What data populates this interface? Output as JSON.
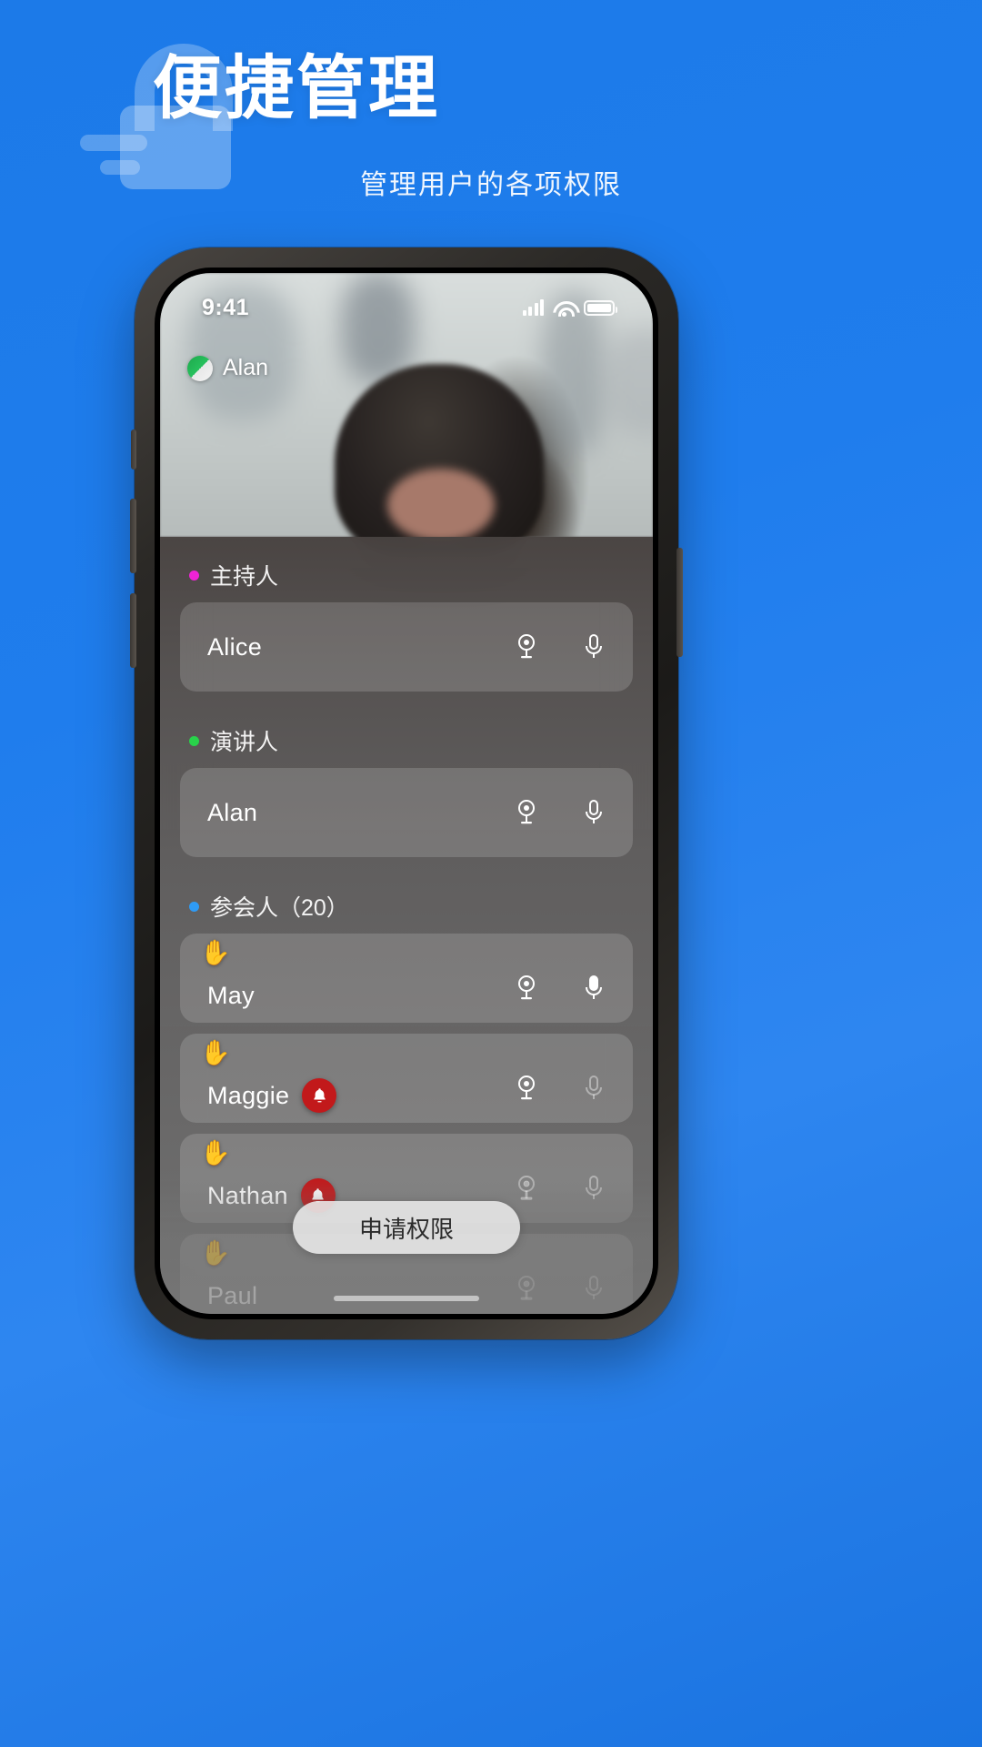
{
  "hero": {
    "title": "便捷管理",
    "subtitle": "管理用户的各项权限",
    "lock_icon": "lock-icon",
    "brand_color": "#1f7ded"
  },
  "phone": {
    "statusbar": {
      "time": "9:41",
      "signal_icon": "cellular-signal-icon",
      "wifi_icon": "wifi-icon",
      "battery_icon": "battery-full-icon"
    },
    "video": {
      "self_name": "Alan",
      "avatar_icon": "avatar-icon"
    },
    "panel": {
      "sections": [
        {
          "label": "主持人",
          "dot_color": "#ef23d6",
          "participants": [
            {
              "name": "Alice",
              "hand_raised": false,
              "bell": false,
              "camera": "on",
              "mic": "on",
              "camera_icon": "camera-icon",
              "mic_icon": "microphone-icon"
            }
          ]
        },
        {
          "label": "演讲人",
          "dot_color": "#28d24a",
          "participants": [
            {
              "name": "Alan",
              "hand_raised": false,
              "bell": false,
              "camera": "on",
              "mic": "on",
              "camera_icon": "camera-icon",
              "mic_icon": "microphone-icon"
            }
          ]
        },
        {
          "label": "参会人（20）",
          "dot_color": "#2f9bf5",
          "participants": [
            {
              "name": "May",
              "hand_raised": true,
              "bell": false,
              "camera": "on",
              "mic": "on",
              "hand_icon": "raised-hand-icon",
              "camera_icon": "camera-icon",
              "mic_icon": "microphone-icon"
            },
            {
              "name": "Maggie",
              "hand_raised": true,
              "bell": true,
              "camera": "on",
              "mic": "off",
              "hand_icon": "raised-hand-icon",
              "bell_icon": "bell-icon",
              "camera_icon": "camera-icon",
              "mic_icon": "microphone-icon"
            },
            {
              "name": "Nathan",
              "hand_raised": true,
              "bell": true,
              "camera": "off",
              "mic": "off",
              "hand_icon": "raised-hand-icon",
              "bell_icon": "bell-icon",
              "camera_icon": "camera-icon",
              "mic_icon": "microphone-icon"
            },
            {
              "name": "Paul",
              "hand_raised": true,
              "bell": false,
              "camera": "off",
              "mic": "off",
              "hand_icon": "raised-hand-icon",
              "camera_icon": "camera-icon",
              "mic_icon": "microphone-icon"
            }
          ]
        }
      ],
      "apply_button": "申请权限"
    }
  }
}
